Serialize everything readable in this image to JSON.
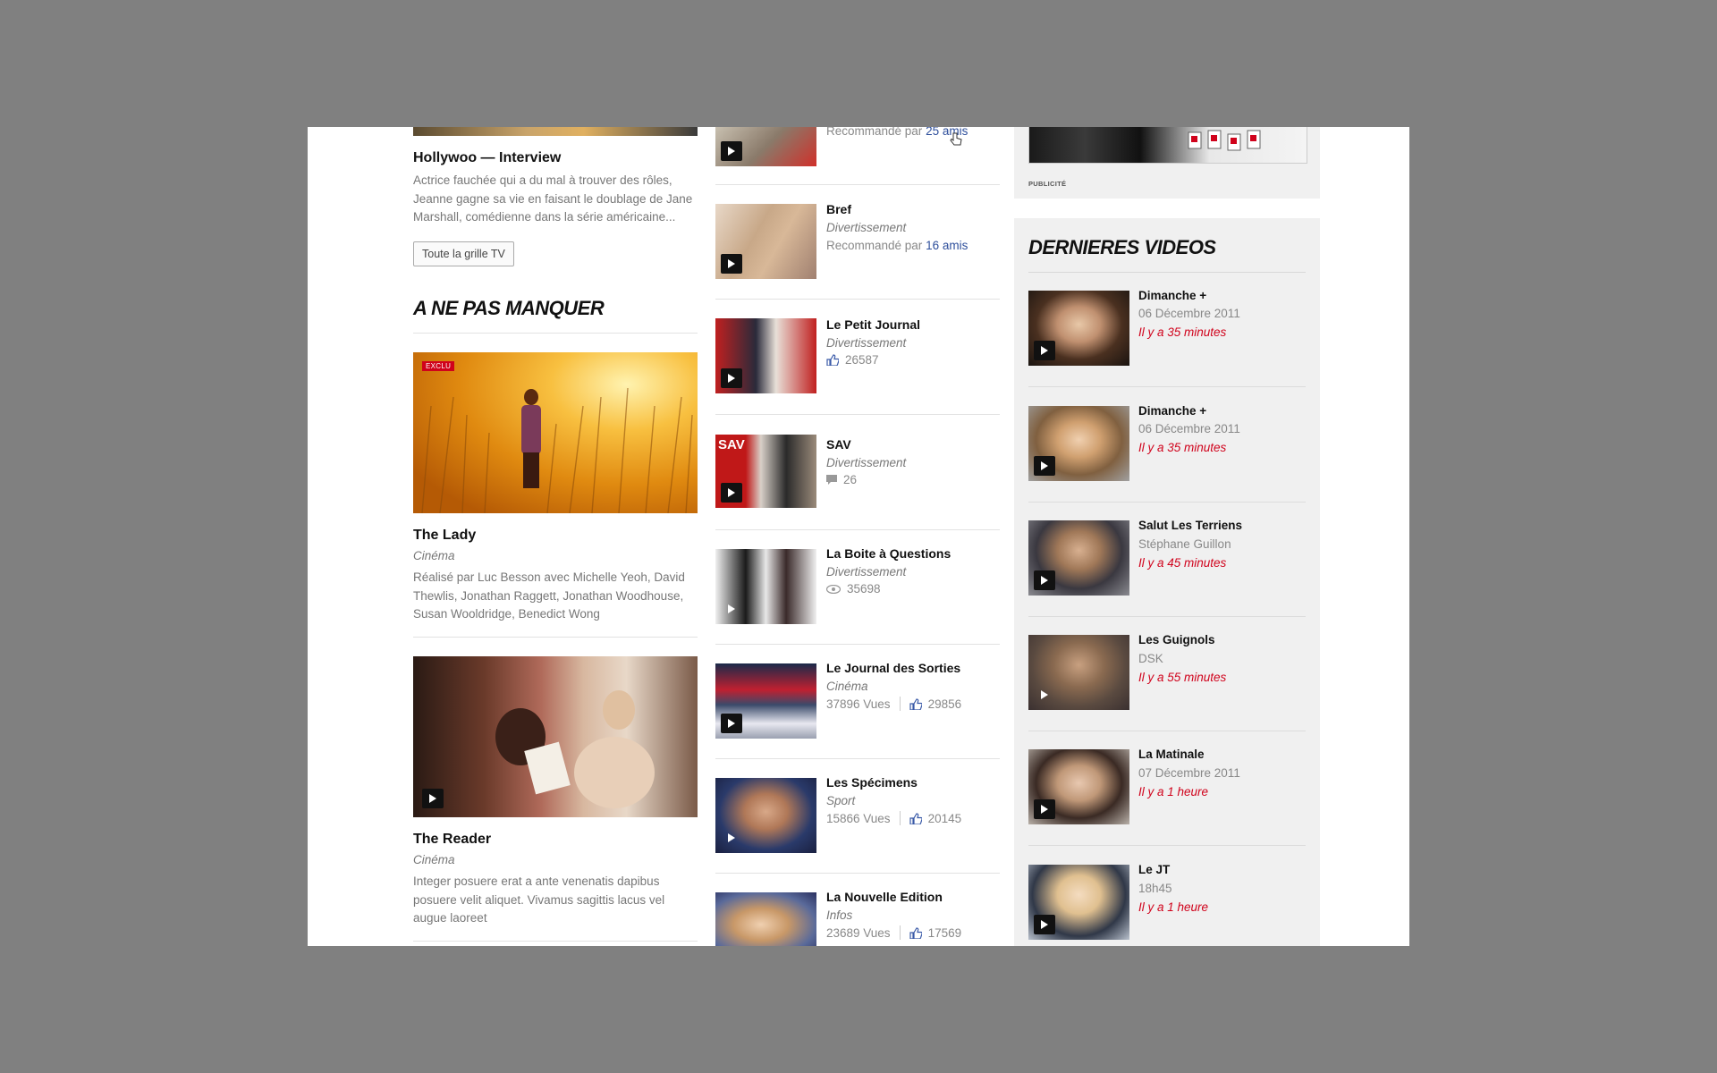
{
  "left": {
    "top_article": {
      "title": "Hollywoo — Interview",
      "description": "Actrice fauchée qui a du mal à trouver des rôles, Jeanne gagne sa vie en faisant le doublage de Jane Marshall, comédienne dans la série américaine...",
      "button": "Toute la grille TV"
    },
    "section_title": "A NE PAS MANQUER",
    "features": [
      {
        "badge": "EXCLU",
        "title": "The Lady",
        "category": "Cinéma",
        "description": "Réalisé par Luc Besson avec Michelle Yeoh, David Thewlis, Jonathan Raggett, Jonathan Woodhouse, Susan Wooldridge, Benedict Wong"
      },
      {
        "title": "The Reader",
        "category": "Cinéma",
        "description": "Integer posuere erat a ante venenatis dapibus posuere velit aliquet. Vivamus sagittis lacus vel augue laoreet"
      }
    ]
  },
  "middle": {
    "top_item": {
      "prefix": "Recommandé par ",
      "link": "25 amis"
    },
    "items": [
      {
        "title": "Bref",
        "category": "Divertissement",
        "rec_prefix": "Recommandé par ",
        "rec_link": "16 amis"
      },
      {
        "title": "Le Petit Journal",
        "category": "Divertissement",
        "likes": "26587"
      },
      {
        "title": "SAV",
        "category": "Divertissement",
        "comments": "26"
      },
      {
        "title": "La Boite à Questions",
        "category": "Divertissement",
        "views": "35698"
      },
      {
        "title": "Le Journal des Sorties",
        "category": "Cinéma",
        "views_text": "37896 Vues",
        "likes": "29856"
      },
      {
        "title": "Les Spécimens",
        "category": "Sport",
        "views_text": "15866 Vues",
        "likes": "20145"
      },
      {
        "title": "La Nouvelle Edition",
        "category": "Infos",
        "views_text": "23689 Vues",
        "likes": "17569"
      }
    ]
  },
  "right": {
    "ad_label": "PUBLICITÉ",
    "section_title": "DERNIERES VIDEOS",
    "videos": [
      {
        "title": "Dimanche +",
        "subtitle": "06 Décembre 2011",
        "time": "Il y a 35 minutes"
      },
      {
        "title": "Dimanche +",
        "subtitle": "06 Décembre 2011",
        "time": "Il y a 35 minutes"
      },
      {
        "title": "Salut Les Terriens",
        "subtitle": "Stéphane Guillon",
        "time": "Il y a 45 minutes"
      },
      {
        "title": "Les Guignols",
        "subtitle": "DSK",
        "time": "Il y a 55 minutes"
      },
      {
        "title": "La Matinale",
        "subtitle": "07 Décembre 2011",
        "time": "Il y a 1 heure"
      },
      {
        "title": "Le JT",
        "subtitle": "18h45",
        "time": "Il y a 1 heure"
      }
    ]
  },
  "colors": {
    "accent_red": "#d0021b",
    "link_blue": "#2d4e9b",
    "backdrop": "#808080"
  }
}
